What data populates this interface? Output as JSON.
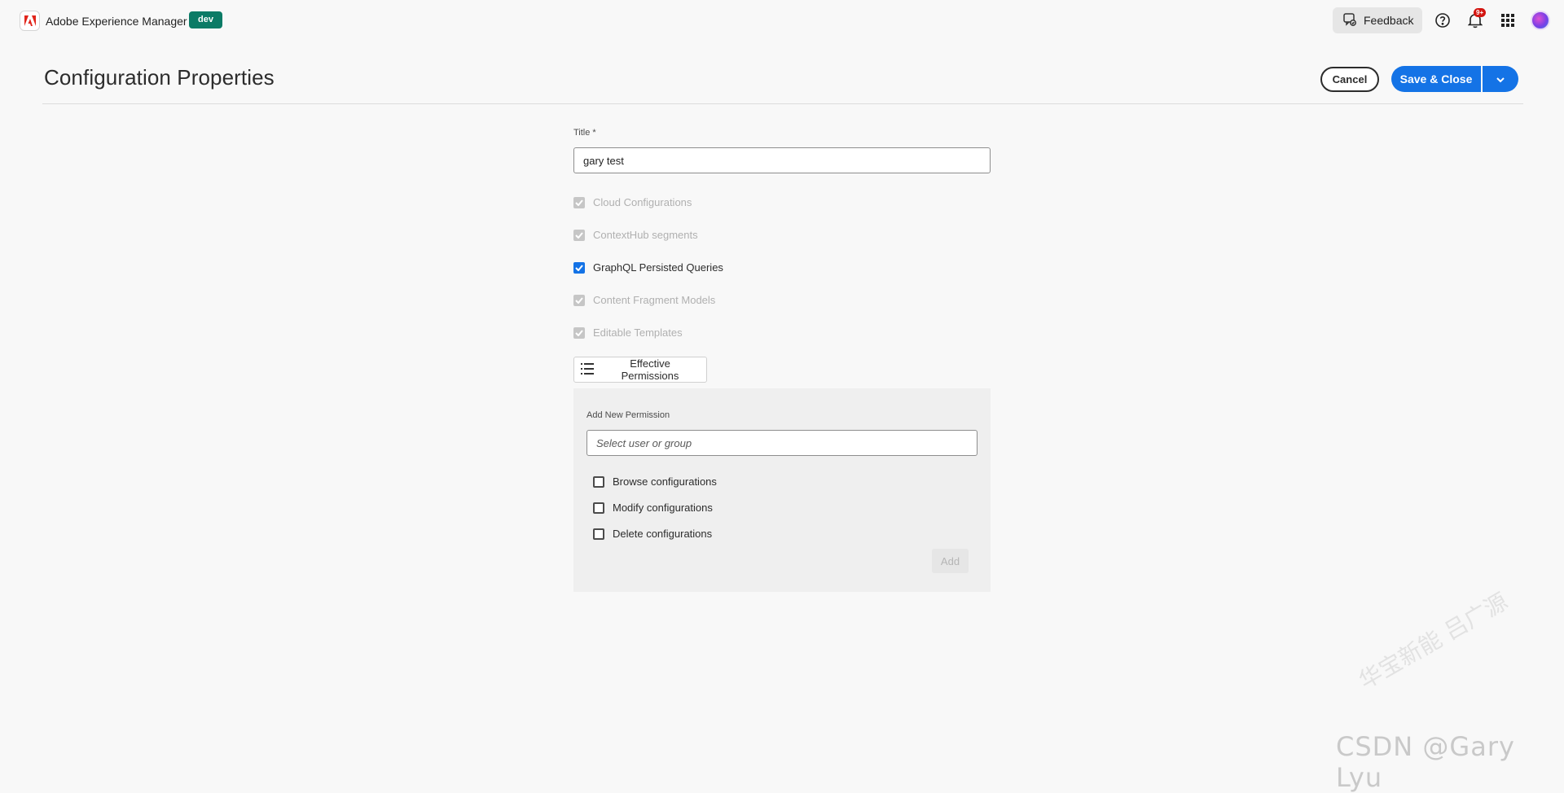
{
  "app": {
    "name": "Adobe Experience Manager",
    "environment": "dev"
  },
  "topbar": {
    "feedback_label": "Feedback",
    "notifications_count": "9+",
    "icons": [
      "help-icon",
      "bell-icon",
      "apps-grid-icon",
      "avatar"
    ]
  },
  "page": {
    "title": "Configuration Properties",
    "cancel_label": "Cancel",
    "save_label": "Save & Close"
  },
  "form": {
    "title_label": "Title *",
    "title_value": "gary test",
    "options": [
      {
        "label": "Cloud Configurations",
        "checked": true,
        "disabled": true
      },
      {
        "label": "ContextHub segments",
        "checked": true,
        "disabled": true
      },
      {
        "label": "GraphQL Persisted Queries",
        "checked": true,
        "disabled": false
      },
      {
        "label": "Content Fragment Models",
        "checked": true,
        "disabled": true
      },
      {
        "label": "Editable Templates",
        "checked": true,
        "disabled": true
      }
    ],
    "effective_permissions_label": "Effective Permissions"
  },
  "permissions": {
    "add_label": "Add New Permission",
    "placeholder": "Select user or group",
    "checkboxes": [
      {
        "label": "Browse configurations",
        "checked": false
      },
      {
        "label": "Modify configurations",
        "checked": false
      },
      {
        "label": "Delete configurations",
        "checked": false
      }
    ],
    "add_button": "Add"
  },
  "watermark": {
    "text": "CSDN @Gary Lyu",
    "text_cn": "华宝新能 吕广源"
  },
  "colors": {
    "accent": "#1473e6",
    "env_badge": "#0b7b66",
    "notif_badge": "#d31510"
  }
}
